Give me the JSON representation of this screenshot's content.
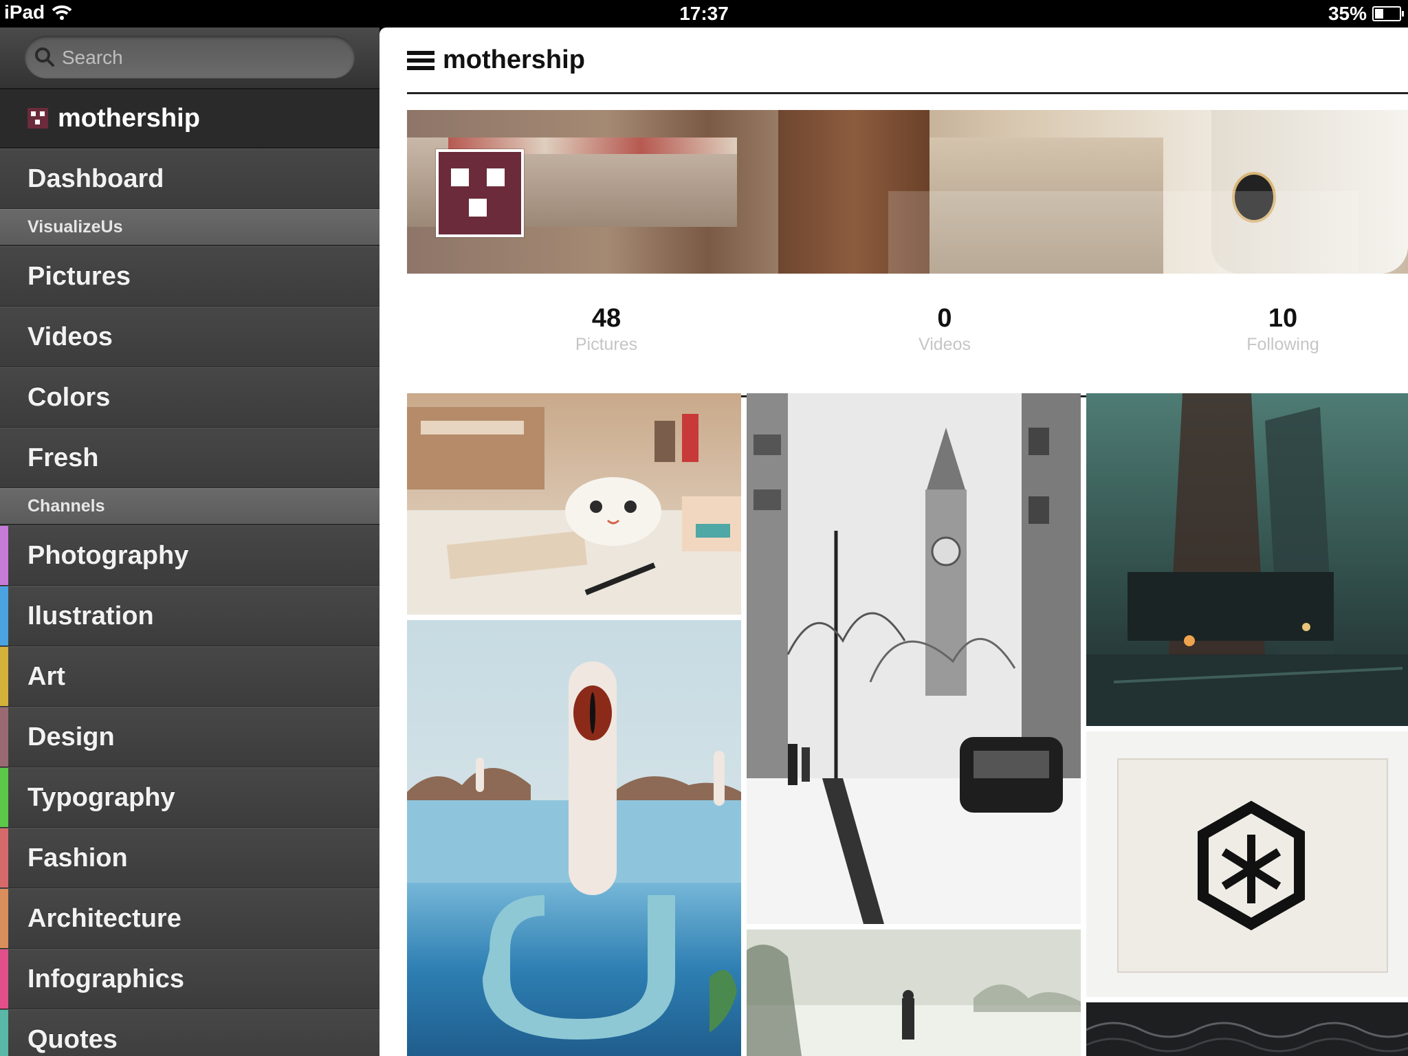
{
  "status_bar": {
    "device": "iPad",
    "time": "17:37",
    "battery": "35%",
    "battery_level": 0.35
  },
  "sidebar": {
    "search_placeholder": "Search",
    "account_name": "mothership",
    "dashboard_label": "Dashboard",
    "sections": [
      {
        "title": "VisualizeUs",
        "items": [
          "Pictures",
          "Videos",
          "Colors",
          "Fresh"
        ]
      },
      {
        "title": "Channels",
        "items": [
          {
            "label": "Photography",
            "color": "#c67bd8"
          },
          {
            "label": "Ilustration",
            "color": "#4aa3df"
          },
          {
            "label": "Art",
            "color": "#d4b13a"
          },
          {
            "label": "Design",
            "color": "#9a6a72"
          },
          {
            "label": "Typography",
            "color": "#5cc84a"
          },
          {
            "label": "Fashion",
            "color": "#d66a6a"
          },
          {
            "label": "Architecture",
            "color": "#d98f5b"
          },
          {
            "label": "Infographics",
            "color": "#e24f8a"
          },
          {
            "label": "Quotes",
            "color": "#5ab8a8"
          }
        ]
      }
    ]
  },
  "main": {
    "title": "mothership",
    "stats": [
      {
        "value": "48",
        "label": "Pictures"
      },
      {
        "value": "0",
        "label": "Videos"
      },
      {
        "value": "10",
        "label": "Following"
      }
    ]
  },
  "colors": {
    "brand": "#6b2b3a",
    "sidebar_bg": "#3f3f3f",
    "text_dark": "#111111",
    "stat_label": "#c5c5c5"
  }
}
